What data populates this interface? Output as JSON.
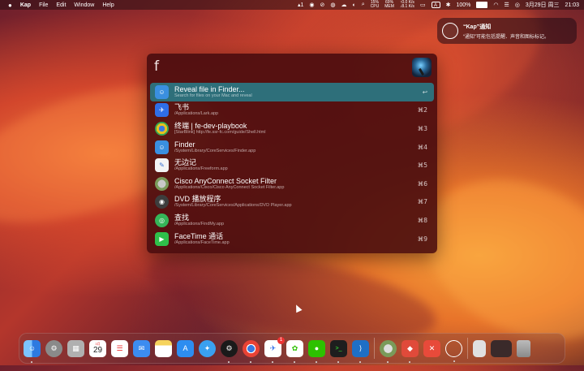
{
  "menubar": {
    "apple": "",
    "app_name": "Kap",
    "menus": [
      "File",
      "Edit",
      "Window",
      "Help"
    ],
    "status": {
      "notif_count": "1",
      "cpu": "15%",
      "cpu_label": "CPU",
      "mem": "69%",
      "mem_label": "MEM",
      "net_up": "0.0 K/s",
      "net_down": "8.1 K/s",
      "input": "A",
      "battery": "100%",
      "date": "3月29日 周三",
      "time": "21:03"
    }
  },
  "notification": {
    "title": "“Kap”通知",
    "body": "“通知”可能包括提醒、声音和图标标记。"
  },
  "kap": {
    "query": "f",
    "results": [
      {
        "title": "Reveal file in Finder...",
        "subtitle": "Search for files on your Mac and reveal",
        "shortcut": "↩",
        "icon": "finder-icon",
        "color": "#3a8fe0"
      },
      {
        "title": "飞书",
        "subtitle": "/Applications/Lark.app",
        "shortcut": "⌘2",
        "icon": "lark-icon",
        "color": "#2f6ee8"
      },
      {
        "title": "终端 | fe-dev-playbook",
        "subtitle": "[StarBlink] http://fe.ssr-fc.com/guide/Shell.html",
        "shortcut": "⌘3",
        "icon": "chrome-icon",
        "color": "#d9a21e"
      },
      {
        "title": "Finder",
        "subtitle": "/System/Library/CoreServices/Finder.app",
        "shortcut": "⌘4",
        "icon": "finder-icon",
        "color": "#3a8fe0"
      },
      {
        "title": "无边记",
        "subtitle": "/Applications/Freeform.app",
        "shortcut": "⌘5",
        "icon": "freeform-icon",
        "color": "#f3f3f3"
      },
      {
        "title": "Cisco AnyConnect Socket Filter",
        "subtitle": "/Applications/Cisco/Cisco AnyConnect Socket Filter.app",
        "shortcut": "⌘6",
        "icon": "cisco-icon",
        "color": "#9a9a9a"
      },
      {
        "title": "DVD 播放程序",
        "subtitle": "/System/Library/CoreServices/Applications/DVD Player.app",
        "shortcut": "⌘7",
        "icon": "dvd-icon",
        "color": "#3d3d3d"
      },
      {
        "title": "查找",
        "subtitle": "/Applications/FindMy.app",
        "shortcut": "⌘8",
        "icon": "findmy-icon",
        "color": "#35b558"
      },
      {
        "title": "FaceTime 通话",
        "subtitle": "/Applications/FaceTime.app",
        "shortcut": "⌘9",
        "icon": "facetime-icon",
        "color": "#2fbf4a"
      }
    ]
  },
  "dock": {
    "calendar_month": "3月",
    "calendar_day": "29",
    "lark_badge": "1",
    "apps": [
      {
        "name": "finder-icon",
        "color": "#4aa0f0"
      },
      {
        "name": "system-settings-icon",
        "color": "#8a8a8a"
      },
      {
        "name": "launchpad-icon",
        "color": "#b0b0b0"
      },
      {
        "name": "calendar-icon",
        "color": "#ffffff"
      },
      {
        "name": "reminders-icon",
        "color": "#ffffff"
      },
      {
        "name": "mail-icon",
        "color": "#3c8cf0"
      },
      {
        "name": "notes-icon",
        "color": "#f6d35c"
      },
      {
        "name": "app-store-icon",
        "color": "#2d8df0"
      },
      {
        "name": "safari-icon",
        "color": "#3aa0f0"
      },
      {
        "name": "steam-icon",
        "color": "#1a1a1a"
      },
      {
        "name": "chrome-icon",
        "color": "#e8e8e8"
      },
      {
        "name": "lark-icon",
        "color": "#ffffff"
      },
      {
        "name": "wechat-work-icon",
        "color": "#ffffff"
      },
      {
        "name": "wechat-icon",
        "color": "#2dc100"
      },
      {
        "name": "terminal-icon",
        "color": "#1e1e1e"
      },
      {
        "name": "vscode-icon",
        "color": "#1f6fc5"
      },
      {
        "name": "cisco-anyconnect-icon",
        "color": "#7a9a5a"
      },
      {
        "name": "git-icon",
        "color": "#e04a3a"
      },
      {
        "name": "xmind-icon",
        "color": "#e84a3a"
      },
      {
        "name": "kap-icon",
        "color": "#ffffff"
      },
      {
        "name": "document-icon",
        "color": "#e0e0e0"
      },
      {
        "name": "screenshot-icon",
        "color": "#3a2a2a"
      },
      {
        "name": "trash-icon",
        "color": "#9a9a9a"
      }
    ]
  }
}
